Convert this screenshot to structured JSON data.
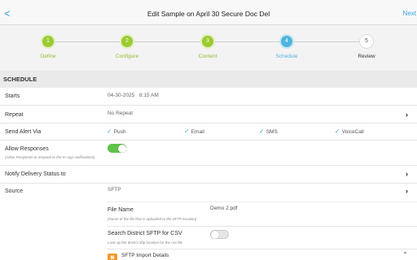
{
  "nav": {
    "back_glyph": "<",
    "title": "Edit Sample on April 30 Secure Doc Del",
    "next_label": "Next"
  },
  "steps": [
    {
      "num": "1",
      "label": "Define",
      "state": "done"
    },
    {
      "num": "2",
      "label": "Configure",
      "state": "done"
    },
    {
      "num": "3",
      "label": "Content",
      "state": "done"
    },
    {
      "num": "4",
      "label": "Schedule",
      "state": "current"
    },
    {
      "num": "5",
      "label": "Review",
      "state": "pending"
    }
  ],
  "section": {
    "title": "SCHEDULE"
  },
  "starts": {
    "label": "Starts",
    "date": "04-30-2025",
    "time": "8:15 AM"
  },
  "repeat": {
    "label": "Repeat",
    "value": "No Repeat"
  },
  "alert": {
    "label": "Send Alert Via",
    "options": [
      {
        "label": "Push",
        "checked": true
      },
      {
        "label": "Email",
        "checked": true
      },
      {
        "label": "SMS",
        "checked": true
      },
      {
        "label": "VoiceCall",
        "checked": true
      }
    ]
  },
  "allow_responses": {
    "label": "Allow Responses",
    "note": "(Allow Recipients to respond to the In-App notifications)",
    "enabled": true
  },
  "notify": {
    "label": "Notify Delivery Status to"
  },
  "source": {
    "label": "Source",
    "value": "SFTP",
    "file_name_label": "File Name",
    "file_name_value": "Demo 2.pdf",
    "file_name_note": "(Name of the file that is uploaded to the SFTP location)",
    "search_label": "Search District SFTP for CSV",
    "search_note": "Look up the district sftp location for the csv file",
    "search_enabled": false,
    "import_label": "SFTP Import Details",
    "import_icon": "sftp-icon"
  },
  "colors": {
    "accent_blue": "#4fb4dd",
    "done_green": "#9bcb2f",
    "toggle_on": "#5fc34a"
  }
}
